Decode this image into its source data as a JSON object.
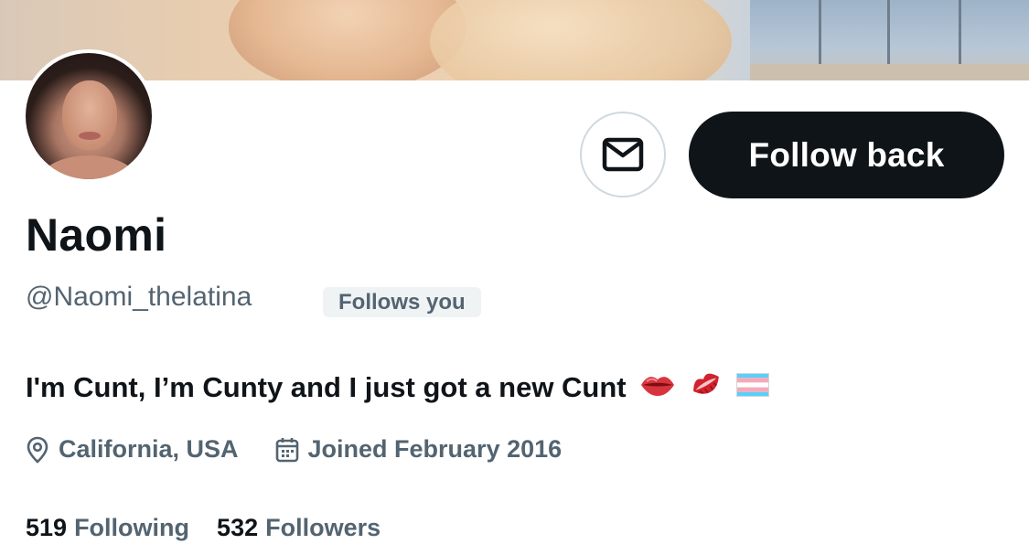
{
  "profile": {
    "display_name": "Naomi",
    "handle": "@Naomi_thelatina",
    "follows_you_badge": "Follows you",
    "bio_text": "I'm Cunt, I’m Cunty and I just got a new Cunt",
    "bio_emojis": [
      "lips",
      "kiss-mark",
      "transgender-flag"
    ],
    "location": "California, USA",
    "joined": "Joined February 2016",
    "following_count": "519",
    "following_label": "Following",
    "followers_count": "532",
    "followers_label": "Followers"
  },
  "actions": {
    "message_icon": "envelope-icon",
    "follow_back_label": "Follow back"
  },
  "colors": {
    "primary_text": "#0f1419",
    "secondary_text": "#536471",
    "button_dark": "#0f1419",
    "border": "#cfd9de",
    "badge_bg": "#eff3f4"
  }
}
